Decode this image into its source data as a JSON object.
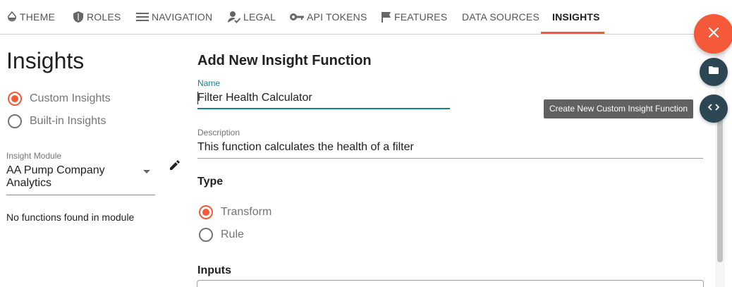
{
  "tabs": [
    {
      "label": "THEME",
      "icon": "theme-drop-icon"
    },
    {
      "label": "ROLES",
      "icon": "shield-icon"
    },
    {
      "label": "NAVIGATION",
      "icon": "menu-icon"
    },
    {
      "label": "LEGAL",
      "icon": "user-check-icon"
    },
    {
      "label": "API TOKENS",
      "icon": "key-icon"
    },
    {
      "label": "FEATURES",
      "icon": "flag-icon"
    },
    {
      "label": "DATA SOURCES"
    },
    {
      "label": "INSIGHTS",
      "active": true
    }
  ],
  "sidebar": {
    "title": "Insights",
    "options": [
      {
        "label": "Custom Insights",
        "selected": true
      },
      {
        "label": "Built-in Insights",
        "selected": false
      }
    ],
    "module_label": "Insight Module",
    "module_value": "AA Pump Company Analytics",
    "empty_text": "No functions found in module"
  },
  "form": {
    "title": "Add New Insight Function",
    "name_label": "Name",
    "name_value": "Filter Health Calculator",
    "description_label": "Description",
    "description_value": "This function calculates the health of a filter",
    "type_heading": "Type",
    "type_options": [
      {
        "label": "Transform",
        "selected": true
      },
      {
        "label": "Rule",
        "selected": false
      }
    ],
    "inputs_heading": "Inputs"
  },
  "fab": {
    "tooltip": "Create New Custom Insight Function"
  },
  "colors": {
    "accent": "#f4593a",
    "teal": "#1a7f8f",
    "fab_dark": "#2c4654"
  }
}
